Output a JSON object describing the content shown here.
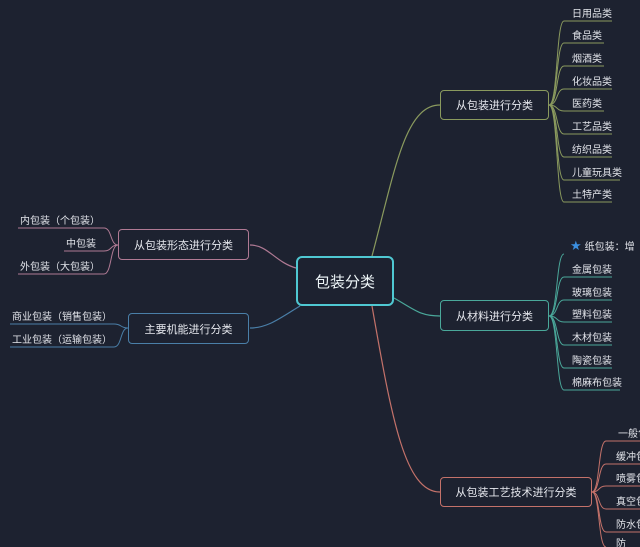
{
  "root": "包装分类",
  "branches": {
    "product": {
      "label": "从包装进行分类",
      "leaves": [
        "日用品类",
        "食品类",
        "烟酒类",
        "化妆品类",
        "医药类",
        "工艺品类",
        "纺织品类",
        "儿童玩具类",
        "土特产类"
      ]
    },
    "material": {
      "label": "从材料进行分类",
      "starred": "纸包装：增",
      "leaves": [
        "金属包装",
        "玻璃包装",
        "塑料包装",
        "木材包装",
        "陶瓷包装",
        "棉麻布包装"
      ]
    },
    "technique": {
      "label": "从包装工艺技术进行分类",
      "leaves": [
        "一般包",
        "缓冲包",
        "喷雾包",
        "真空包",
        "防水包",
        "防"
      ]
    },
    "form": {
      "label": "从包装形态进行分类",
      "leaves": [
        "内包装（个包装）",
        "中包装",
        "外包装（大包装）"
      ]
    },
    "function": {
      "label": "主要机能进行分类",
      "leaves": [
        "商业包装（销售包装）",
        "工业包装（运输包装）"
      ]
    }
  },
  "colors": {
    "background": "#1d2230",
    "root_border": "#4fc8d2",
    "product": "#8a9a5e",
    "form": "#b07a94",
    "function": "#4a7fa8",
    "material": "#4aa89a",
    "technique": "#c4726a",
    "star": "#3b8fe0"
  },
  "icons": {
    "material_starred": "star-icon"
  }
}
